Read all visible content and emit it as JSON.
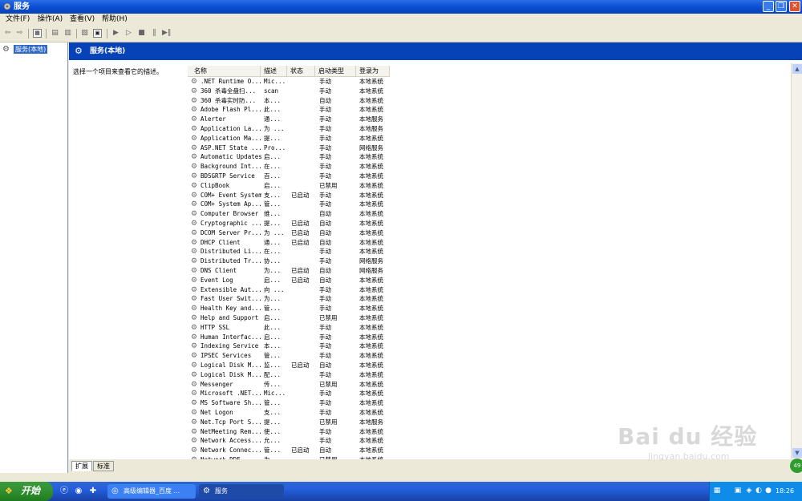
{
  "window": {
    "title": "服务",
    "min_glyph": "_",
    "max_glyph": "❐",
    "close_glyph": "✕"
  },
  "menu": [
    "文件(F)",
    "操作(A)",
    "查看(V)",
    "帮助(H)"
  ],
  "toolbar": {
    "back_glyph": "⇦",
    "forward_glyph": "⇨",
    "play_glyph": "▶",
    "play2_glyph": "▷",
    "stop_glyph": "■",
    "pause_glyph": "‖",
    "restart_glyph": "▶‖"
  },
  "tree": {
    "item": "服务(本地)"
  },
  "header": {
    "title": "服务(本地)"
  },
  "description": {
    "text": "选择一个项目来查看它的描述。"
  },
  "columns": {
    "name": "名称",
    "desc": "描述",
    "status": "状态",
    "startup": "启动类型",
    "logon": "登录为"
  },
  "services": [
    {
      "name": ".NET Runtime O...",
      "desc": "Mic...",
      "status": "",
      "startup": "手动",
      "logon": "本地系统"
    },
    {
      "name": "360 杀毒全盘扫...",
      "desc": "scan",
      "status": "",
      "startup": "手动",
      "logon": "本地系统"
    },
    {
      "name": "360 杀毒实时防...",
      "desc": "本...",
      "status": "",
      "startup": "自动",
      "logon": "本地系统"
    },
    {
      "name": "Adobe Flash Pl...",
      "desc": "此...",
      "status": "",
      "startup": "手动",
      "logon": "本地系统"
    },
    {
      "name": "Alerter",
      "desc": "通...",
      "status": "",
      "startup": "手动",
      "logon": "本地服务"
    },
    {
      "name": "Application La...",
      "desc": "为 ...",
      "status": "",
      "startup": "手动",
      "logon": "本地服务"
    },
    {
      "name": "Application Ma...",
      "desc": "提...",
      "status": "",
      "startup": "手动",
      "logon": "本地系统"
    },
    {
      "name": "ASP.NET State ...",
      "desc": "Pro...",
      "status": "",
      "startup": "手动",
      "logon": "网络服务"
    },
    {
      "name": "Automatic Updates",
      "desc": "启...",
      "status": "",
      "startup": "手动",
      "logon": "本地系统"
    },
    {
      "name": "Background Int...",
      "desc": "在...",
      "status": "",
      "startup": "手动",
      "logon": "本地系统"
    },
    {
      "name": "BDSGRTP Service",
      "desc": "百...",
      "status": "",
      "startup": "手动",
      "logon": "本地系统"
    },
    {
      "name": "ClipBook",
      "desc": "启...",
      "status": "",
      "startup": "已禁用",
      "logon": "本地系统"
    },
    {
      "name": "COM+ Event System",
      "desc": "支...",
      "status": "已启动",
      "startup": "手动",
      "logon": "本地系统"
    },
    {
      "name": "COM+ System Ap...",
      "desc": "管...",
      "status": "",
      "startup": "手动",
      "logon": "本地系统"
    },
    {
      "name": "Computer Browser",
      "desc": "维...",
      "status": "",
      "startup": "自动",
      "logon": "本地系统"
    },
    {
      "name": "Cryptographic ...",
      "desc": "提...",
      "status": "已启动",
      "startup": "自动",
      "logon": "本地系统"
    },
    {
      "name": "DCOM Server Pr...",
      "desc": "为 ...",
      "status": "已启动",
      "startup": "自动",
      "logon": "本地系统"
    },
    {
      "name": "DHCP Client",
      "desc": "通...",
      "status": "已启动",
      "startup": "自动",
      "logon": "本地系统"
    },
    {
      "name": "Distributed Li...",
      "desc": "在...",
      "status": "",
      "startup": "手动",
      "logon": "本地系统"
    },
    {
      "name": "Distributed Tr...",
      "desc": "协...",
      "status": "",
      "startup": "手动",
      "logon": "网络服务"
    },
    {
      "name": "DNS Client",
      "desc": "为...",
      "status": "已启动",
      "startup": "自动",
      "logon": "网络服务"
    },
    {
      "name": "Event Log",
      "desc": "启...",
      "status": "已启动",
      "startup": "自动",
      "logon": "本地系统"
    },
    {
      "name": "Extensible Aut...",
      "desc": "向 ...",
      "status": "",
      "startup": "手动",
      "logon": "本地系统"
    },
    {
      "name": "Fast User Swit...",
      "desc": "为...",
      "status": "",
      "startup": "手动",
      "logon": "本地系统"
    },
    {
      "name": "Health Key and...",
      "desc": "管...",
      "status": "",
      "startup": "手动",
      "logon": "本地系统"
    },
    {
      "name": "Help and Support",
      "desc": "启...",
      "status": "",
      "startup": "已禁用",
      "logon": "本地系统"
    },
    {
      "name": "HTTP SSL",
      "desc": "此...",
      "status": "",
      "startup": "手动",
      "logon": "本地系统"
    },
    {
      "name": "Human Interfac...",
      "desc": "启...",
      "status": "",
      "startup": "手动",
      "logon": "本地系统"
    },
    {
      "name": "Indexing Service",
      "desc": "本...",
      "status": "",
      "startup": "手动",
      "logon": "本地系统"
    },
    {
      "name": "IPSEC Services",
      "desc": "管...",
      "status": "",
      "startup": "手动",
      "logon": "本地系统"
    },
    {
      "name": "Logical Disk M...",
      "desc": "监...",
      "status": "已启动",
      "startup": "自动",
      "logon": "本地系统"
    },
    {
      "name": "Logical Disk M...",
      "desc": "配...",
      "status": "",
      "startup": "手动",
      "logon": "本地系统"
    },
    {
      "name": "Messenger",
      "desc": "传...",
      "status": "",
      "startup": "已禁用",
      "logon": "本地系统"
    },
    {
      "name": "Microsoft .NET...",
      "desc": "Mic...",
      "status": "",
      "startup": "手动",
      "logon": "本地系统"
    },
    {
      "name": "MS Software Sh...",
      "desc": "管...",
      "status": "",
      "startup": "手动",
      "logon": "本地系统"
    },
    {
      "name": "Net Logon",
      "desc": "支...",
      "status": "",
      "startup": "手动",
      "logon": "本地系统"
    },
    {
      "name": "Net.Tcp Port S...",
      "desc": "提...",
      "status": "",
      "startup": "已禁用",
      "logon": "本地服务"
    },
    {
      "name": "NetMeeting Rem...",
      "desc": "使...",
      "status": "",
      "startup": "手动",
      "logon": "本地系统"
    },
    {
      "name": "Network Access...",
      "desc": "允...",
      "status": "",
      "startup": "手动",
      "logon": "本地系统"
    },
    {
      "name": "Network Connec...",
      "desc": "管...",
      "status": "已启动",
      "startup": "自动",
      "logon": "本地系统"
    },
    {
      "name": "Network DDE",
      "desc": "为...",
      "status": "",
      "startup": "已禁用",
      "logon": "本地系统"
    }
  ],
  "tabs": [
    "扩展",
    "标准"
  ],
  "taskbar": {
    "start": "开始",
    "items": [
      "高级编辑器_百度 ...",
      "服务"
    ],
    "clock": "18:26"
  },
  "badge": "49",
  "watermark": {
    "brand": "Bai du 经验",
    "url": "jingyan.baidu.com"
  },
  "colors": {
    "title_blue": "#0a4fd4",
    "selection": "#316ac5",
    "start_green": "#2f8f2f",
    "close_red": "#e0512c"
  }
}
